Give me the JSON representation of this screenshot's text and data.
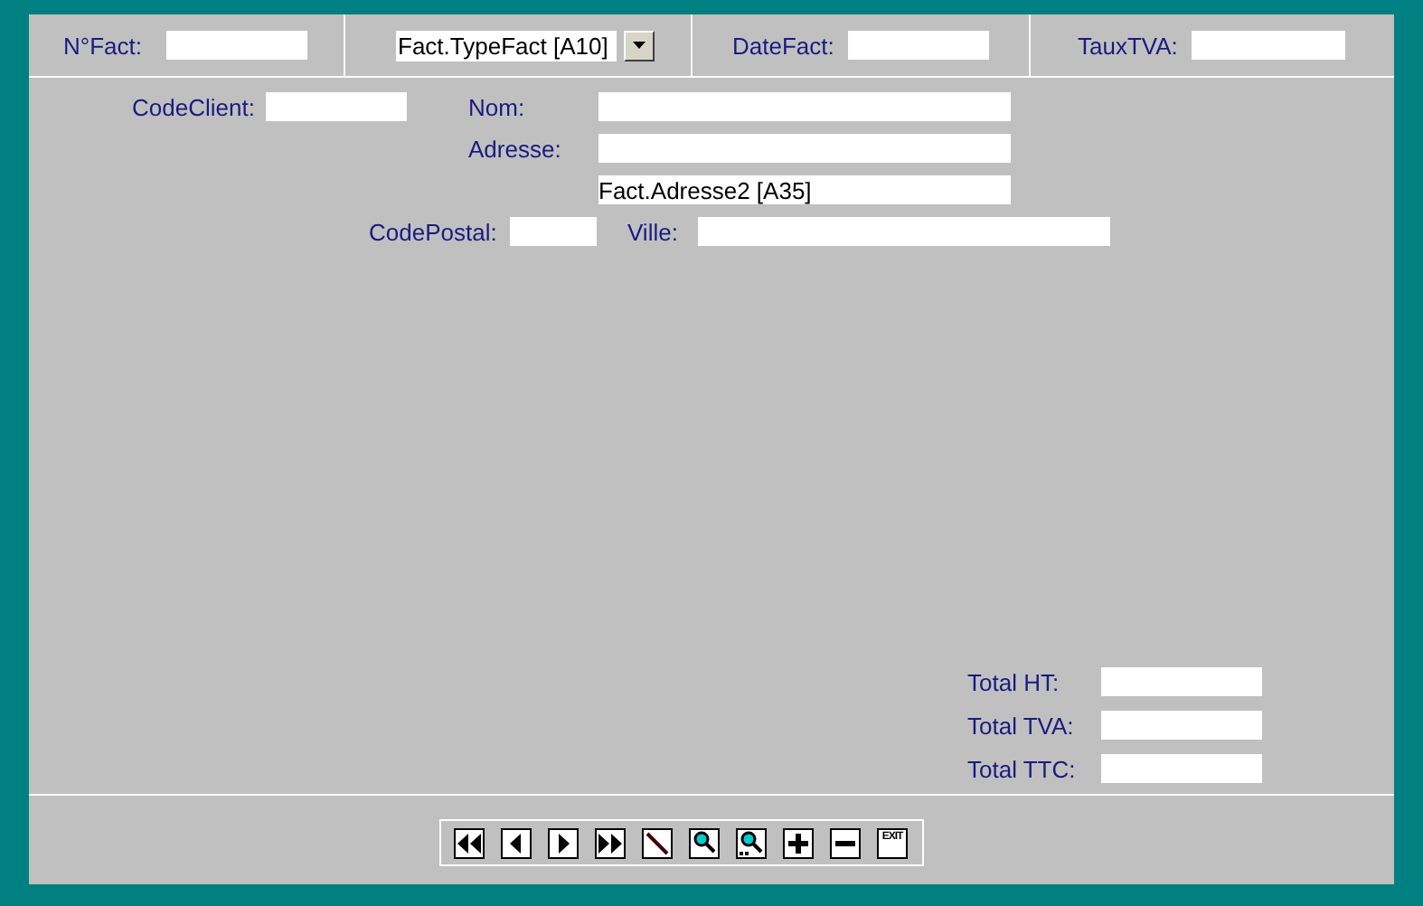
{
  "header": [
    {
      "kind": "field",
      "label": "N°Fact:"
    },
    {
      "kind": "dropdown",
      "value": "Fact.TypeFact [A10]"
    },
    {
      "kind": "field",
      "label": "DateFact:"
    },
    {
      "kind": "field",
      "label": "TauxTVA:"
    }
  ],
  "client": {
    "code": {
      "label": "CodeClient:"
    },
    "nom": {
      "label": "Nom:"
    },
    "adresse": {
      "label": "Adresse:"
    },
    "adresse2": {
      "value": "Fact.Adresse2 [A35]"
    },
    "code_postal": {
      "label": "CodePostal:"
    },
    "ville": {
      "label": "Ville:"
    }
  },
  "totals": [
    {
      "label": "Total HT:"
    },
    {
      "label": "Total TVA:"
    },
    {
      "label": "Total TTC:"
    }
  ],
  "toolbar": [
    {
      "kind": "first"
    },
    {
      "kind": "previous"
    },
    {
      "kind": "next"
    },
    {
      "kind": "last"
    },
    {
      "kind": "edit"
    },
    {
      "kind": "search"
    },
    {
      "kind": "search-all"
    },
    {
      "kind": "add"
    },
    {
      "kind": "remove"
    },
    {
      "kind": "exit",
      "label": "EXIT"
    }
  ]
}
